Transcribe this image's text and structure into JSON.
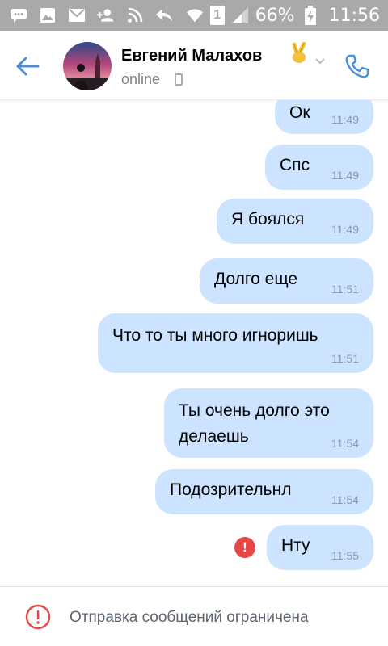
{
  "status_bar": {
    "battery": "66%",
    "time": "11:56",
    "sim_badge": "1"
  },
  "header": {
    "contact_name": "Евгений Малахов",
    "status": "online"
  },
  "messages": [
    {
      "text": "Ок",
      "time": "11:49"
    },
    {
      "text": "Спс",
      "time": "11:49"
    },
    {
      "text": "Я боялся",
      "time": "11:49"
    },
    {
      "text": "Долго еще",
      "time": "11:51"
    },
    {
      "text": "Что то ты много игноришь",
      "time": "11:51"
    },
    {
      "text_line1": "Ты очень долго это",
      "text_line2": "делаешь",
      "time": "11:54"
    },
    {
      "text": "Подозрительнл",
      "time": "11:54"
    },
    {
      "text": "Нту",
      "time": "11:55",
      "failed": "!"
    }
  ],
  "footer": {
    "restriction_text": "Отправка сообщений ограничена"
  },
  "colors": {
    "accent": "#4a90d9",
    "bubble": "#cce4ff",
    "error": "#e64646"
  }
}
